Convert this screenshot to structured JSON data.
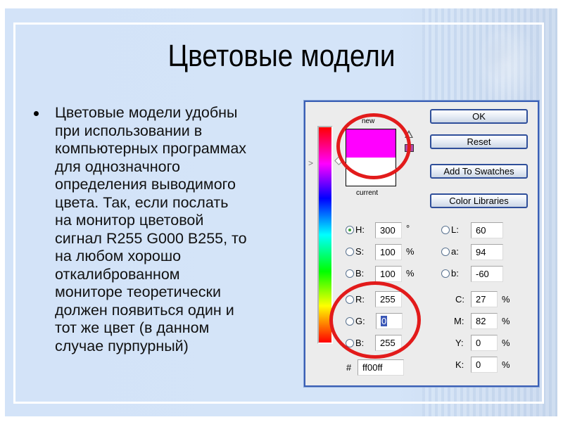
{
  "slide": {
    "title": "Цветовые модели",
    "bullet": "Цветовые модели удобны\nпри использовании в\nкомпьютерных программах\nдля однозначного\nопределения выводимого\nцвета. Так, если послать\nна монитор цветовой\nсигнал R255 G000 B255, то\nна любом хорошо\nоткалиброванном\nмониторе теоретически\nдолжен появиться один и\nтот же цвет (в данном\nслучае пурпурный)"
  },
  "color_picker": {
    "new_label": "new",
    "current_label": "current",
    "new_color": "#ff00ff",
    "current_color": "#ffffff",
    "buttons": {
      "ok": "OK",
      "reset": "Reset",
      "add_to_swatches": "Add To Swatches",
      "color_libraries": "Color Libraries"
    },
    "hsb": [
      {
        "label": "H:",
        "value": "300",
        "unit": "°",
        "selected": true
      },
      {
        "label": "S:",
        "value": "100",
        "unit": "%",
        "selected": false
      },
      {
        "label": "B:",
        "value": "100",
        "unit": "%",
        "selected": false
      }
    ],
    "rgb": [
      {
        "label": "R:",
        "value": "255"
      },
      {
        "label": "G:",
        "value": "0"
      },
      {
        "label": "B:",
        "value": "255"
      }
    ],
    "lab": [
      {
        "label": "L:",
        "value": "60"
      },
      {
        "label": "a:",
        "value": "94"
      },
      {
        "label": "b:",
        "value": "-60"
      }
    ],
    "cmyk": [
      {
        "label": "C:",
        "value": "27",
        "unit": "%"
      },
      {
        "label": "M:",
        "value": "82",
        "unit": "%"
      },
      {
        "label": "Y:",
        "value": "0",
        "unit": "%"
      },
      {
        "label": "K:",
        "value": "0",
        "unit": "%"
      }
    ],
    "hex_label": "#",
    "hex_value": "ff00ff"
  },
  "annotation_color": "#e21b1b"
}
